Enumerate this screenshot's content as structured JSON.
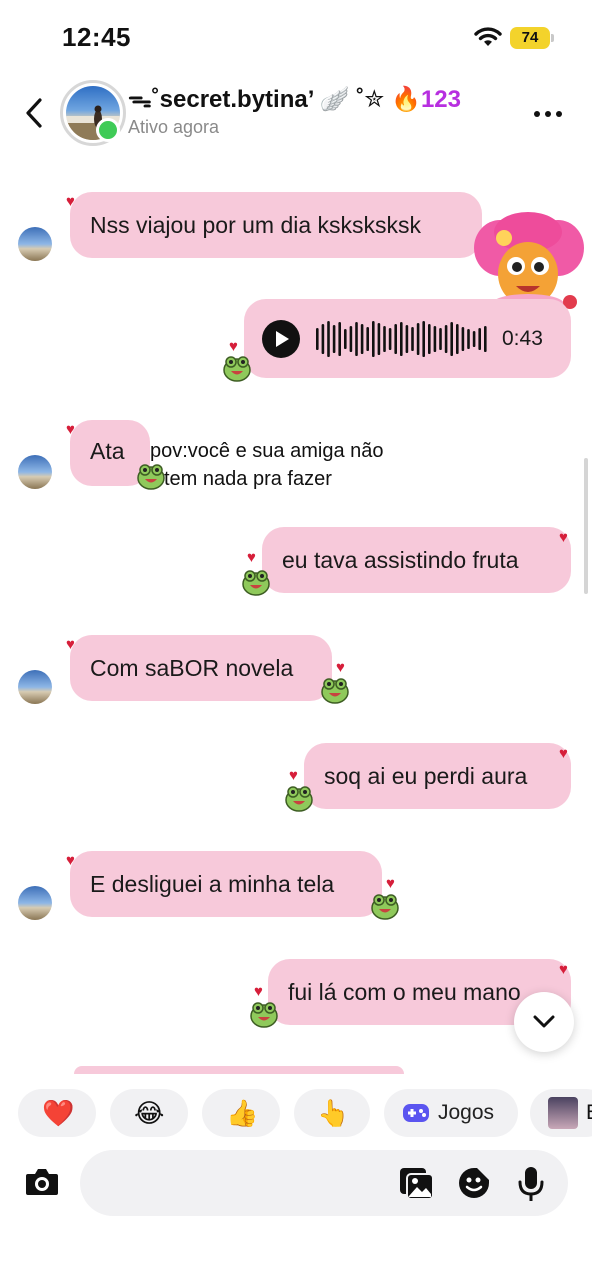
{
  "status_bar": {
    "time": "12:45",
    "battery": "74"
  },
  "header": {
    "name_prefix": "ᯓ˚secret.bytina’",
    "name_decor": " 🪽 ˚✮ ",
    "fire_label": "🔥123",
    "status": "Ativo agora"
  },
  "messages": [
    {
      "side": "received",
      "text": "Nss viajou por um dia ksksksksk"
    },
    {
      "side": "sent",
      "type": "audio",
      "duration": "0:43"
    },
    {
      "side": "received",
      "text": "Ata"
    },
    {
      "side": "sent",
      "text": "eu tava assistindo fruta"
    },
    {
      "side": "received",
      "text": "Com saBOR novela"
    },
    {
      "side": "sent",
      "text": "soq ai eu perdi aura"
    },
    {
      "side": "received",
      "text": "E desliguei a minha tela"
    },
    {
      "side": "sent",
      "text": "fui lá com o meu mano"
    }
  ],
  "overlay_caption": {
    "line1": "pov:você e sua amiga não",
    "line2": "tem nada pra fazer"
  },
  "quick_reactions": [
    {
      "emoji": "❤️",
      "icon": "heart-icon"
    },
    {
      "emoji": "😂",
      "icon": "laughing-icon"
    },
    {
      "emoji": "👍",
      "icon": "thumbs-up-icon"
    },
    {
      "emoji": "👆",
      "icon": "pointing-up-icon"
    },
    {
      "label": "Jogos",
      "icon": "gamepad-icon"
    },
    {
      "label": "E",
      "icon": "avatar"
    }
  ],
  "colors": {
    "bubble": "#f7c9da",
    "online": "#3fcb57",
    "heart": "#d61e3a",
    "battery": "#f3d32b",
    "fire_text": "#b72fe0"
  }
}
